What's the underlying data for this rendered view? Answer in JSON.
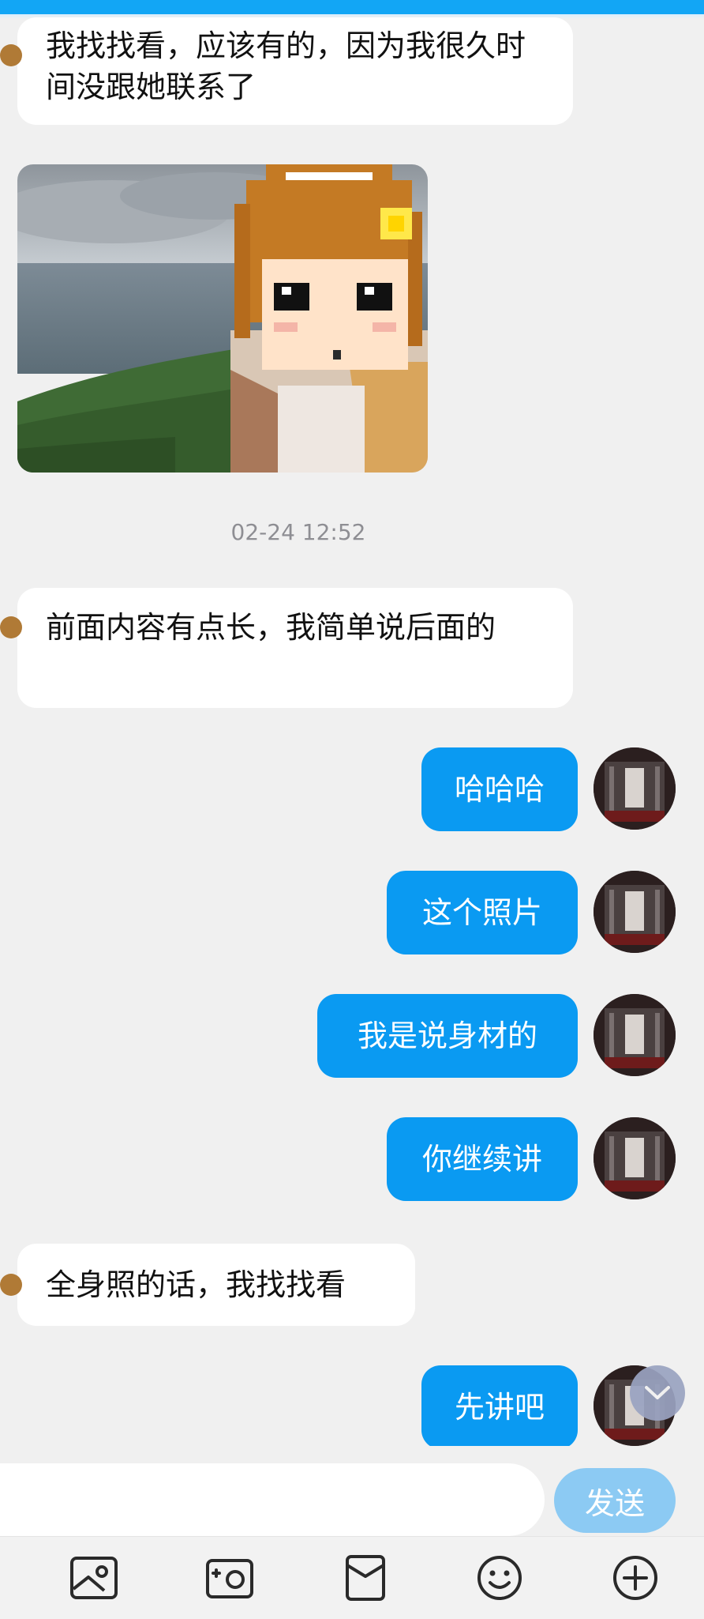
{
  "messages": {
    "m1": "我找找看，应该有的，因为我很久时间没跟她联系了",
    "m2": "前面内容有点长，我简单说后面的",
    "m3": "哈哈哈",
    "m4": "这个照片",
    "m5": "我是说身材的",
    "m6": "你继续讲",
    "m7": "全身照的话，我找找看",
    "m8": "先讲吧"
  },
  "timestamp": "02-24 12:52",
  "input": {
    "value": "",
    "placeholder": ""
  },
  "send_label": "发送",
  "toolbar_icons": [
    "photo-icon",
    "camera-icon",
    "red-packet-icon",
    "emoji-icon",
    "plus-icon"
  ],
  "colors": {
    "accent": "#0a9af2",
    "send_disabled": "#8ccaf3",
    "topbar": "#12a6f5"
  }
}
